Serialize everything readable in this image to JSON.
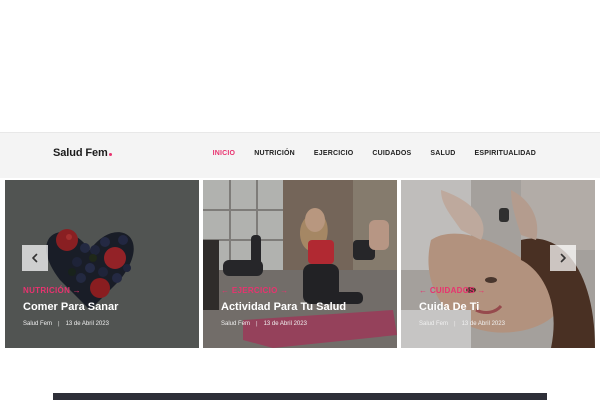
{
  "header": {
    "logo_text": "Salud Fem",
    "nav": [
      {
        "label": "INICIO",
        "active": true
      },
      {
        "label": "NUTRICIÓN",
        "active": false
      },
      {
        "label": "EJERCICIO",
        "active": false
      },
      {
        "label": "CUIDADOS",
        "active": false
      },
      {
        "label": "SALUD",
        "active": false
      },
      {
        "label": "ESPIRITUALIDAD",
        "active": false
      }
    ]
  },
  "slides": [
    {
      "category": "NUTRICIÓN",
      "title": "Comer Para Sanar",
      "author": "Salud Fem",
      "date": "13 de Abril 2023"
    },
    {
      "category": "EJERCICIO",
      "title": "Actividad Para Tu Salud",
      "author": "Salud Fem",
      "date": "13 de Abril 2023"
    },
    {
      "category": "CUIDADOS",
      "title": "Cuida De Ti",
      "author": "Salud Fem",
      "date": "13 de Abril 2023"
    }
  ],
  "slider": {
    "prev_icon": "chevron-left-icon",
    "next_icon": "chevron-right-icon"
  },
  "colors": {
    "accent": "#e8336f",
    "text_dark": "#1c1c1c"
  }
}
